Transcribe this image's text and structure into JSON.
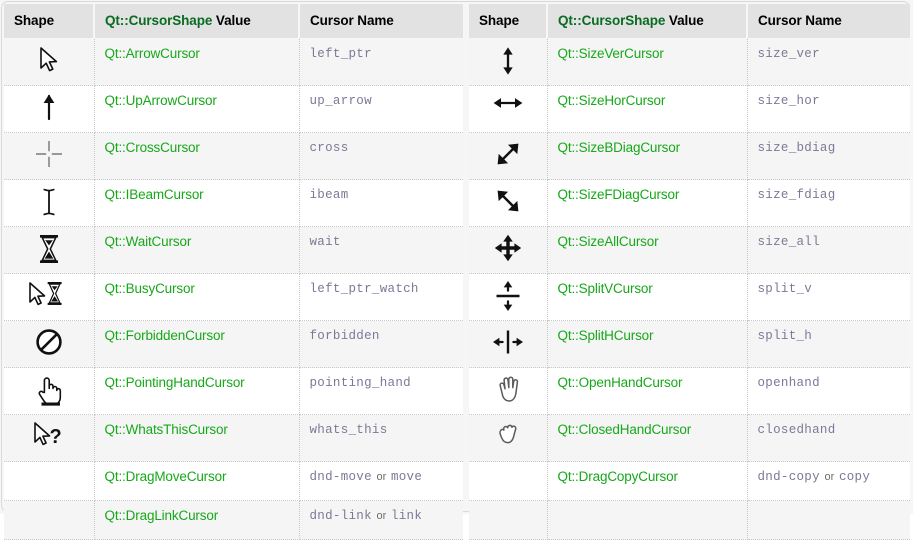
{
  "columns": {
    "shape": "Shape",
    "value_prefix": "Qt::CursorShape",
    "value_suffix": " Value",
    "name": "Cursor Name"
  },
  "colors": {
    "link_green": "#17a81a",
    "header_green": "#0a6b22",
    "code_slate": "#7a7a96",
    "header_bg": "#e2e2e2",
    "row_odd_bg": "#f5f5f5",
    "row_even_bg": "#ffffff",
    "border_dotted": "#c8c8c8",
    "page_bg": "#f6f6f6"
  },
  "left_table": {
    "rows": [
      {
        "icon": "arrow-cursor-icon",
        "value": "Qt::ArrowCursor",
        "name": "left_ptr",
        "name2": null,
        "or": null
      },
      {
        "icon": "up-arrow-cursor-icon",
        "value": "Qt::UpArrowCursor",
        "name": "up_arrow",
        "name2": null,
        "or": null
      },
      {
        "icon": "cross-cursor-icon",
        "value": "Qt::CrossCursor",
        "name": "cross",
        "name2": null,
        "or": null
      },
      {
        "icon": "ibeam-cursor-icon",
        "value": "Qt::IBeamCursor",
        "name": "ibeam",
        "name2": null,
        "or": null
      },
      {
        "icon": "wait-cursor-icon",
        "value": "Qt::WaitCursor",
        "name": "wait",
        "name2": null,
        "or": null
      },
      {
        "icon": "busy-cursor-icon",
        "value": "Qt::BusyCursor",
        "name": "left_ptr_watch",
        "name2": null,
        "or": null
      },
      {
        "icon": "forbidden-cursor-icon",
        "value": "Qt::ForbiddenCursor",
        "name": "forbidden",
        "name2": null,
        "or": null
      },
      {
        "icon": "pointing-hand-cursor-icon",
        "value": "Qt::PointingHandCursor",
        "name": "pointing_hand",
        "name2": null,
        "or": null
      },
      {
        "icon": "whats-this-cursor-icon",
        "value": "Qt::WhatsThisCursor",
        "name": "whats_this",
        "name2": null,
        "or": null
      },
      {
        "icon": "none",
        "value": "Qt::DragMoveCursor",
        "name": "dnd-move",
        "name2": "move",
        "or": "or"
      },
      {
        "icon": "none",
        "value": "Qt::DragLinkCursor",
        "name": "dnd-link",
        "name2": "link",
        "or": "or"
      }
    ]
  },
  "right_table": {
    "rows": [
      {
        "icon": "size-ver-cursor-icon",
        "value": "Qt::SizeVerCursor",
        "name": "size_ver",
        "name2": null,
        "or": null
      },
      {
        "icon": "size-hor-cursor-icon",
        "value": "Qt::SizeHorCursor",
        "name": "size_hor",
        "name2": null,
        "or": null
      },
      {
        "icon": "size-bdiag-cursor-icon",
        "value": "Qt::SizeBDiagCursor",
        "name": "size_bdiag",
        "name2": null,
        "or": null
      },
      {
        "icon": "size-fdiag-cursor-icon",
        "value": "Qt::SizeFDiagCursor",
        "name": "size_fdiag",
        "name2": null,
        "or": null
      },
      {
        "icon": "size-all-cursor-icon",
        "value": "Qt::SizeAllCursor",
        "name": "size_all",
        "name2": null,
        "or": null
      },
      {
        "icon": "split-v-cursor-icon",
        "value": "Qt::SplitVCursor",
        "name": "split_v",
        "name2": null,
        "or": null
      },
      {
        "icon": "split-h-cursor-icon",
        "value": "Qt::SplitHCursor",
        "name": "split_h",
        "name2": null,
        "or": null
      },
      {
        "icon": "open-hand-cursor-icon",
        "value": "Qt::OpenHandCursor",
        "name": "openhand",
        "name2": null,
        "or": null
      },
      {
        "icon": "closed-hand-cursor-icon",
        "value": "Qt::ClosedHandCursor",
        "name": "closedhand",
        "name2": null,
        "or": null
      },
      {
        "icon": "none",
        "value": "Qt::DragCopyCursor",
        "name": "dnd-copy",
        "name2": "copy",
        "or": "or"
      },
      {
        "icon": "none",
        "value": "",
        "name": "",
        "name2": null,
        "or": null
      }
    ]
  }
}
